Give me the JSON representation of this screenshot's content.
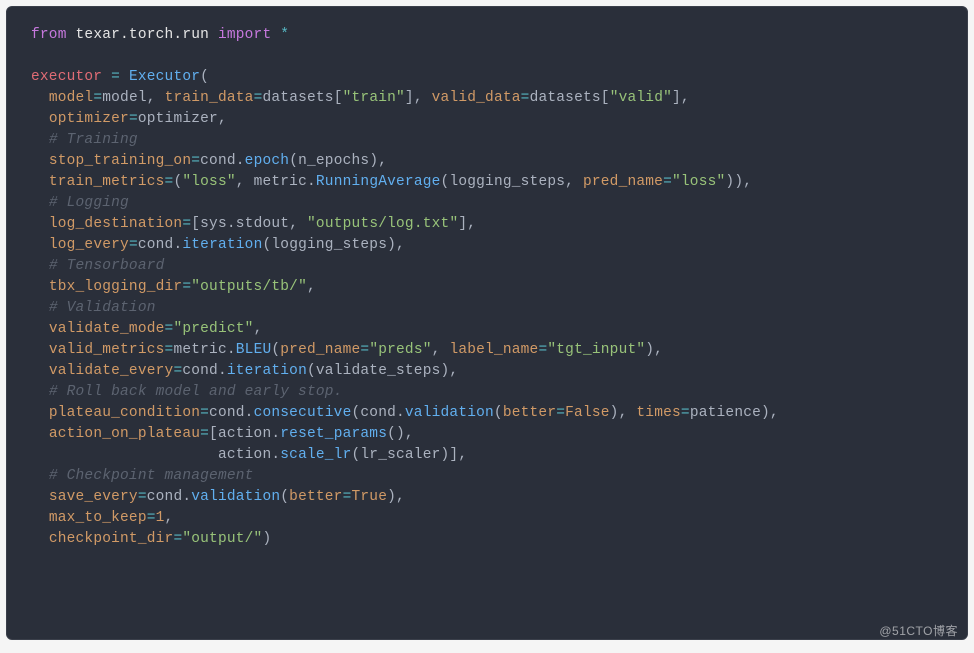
{
  "code": {
    "l1": {
      "from": "from",
      "mod": "texar.torch.run",
      "imp": "import",
      "star": "*"
    },
    "l3": {
      "lhs": "executor",
      "eq": "=",
      "fn": "Executor",
      "open": "("
    },
    "l4": {
      "p1": "model",
      "v1": "model",
      "p2": "train_data",
      "v2a": "datasets",
      "v2b": "\"train\"",
      "p3": "valid_data",
      "v3a": "datasets",
      "v3b": "\"valid\""
    },
    "l5": {
      "p": "optimizer",
      "v": "optimizer"
    },
    "l6": {
      "c": "# Training"
    },
    "l7": {
      "p": "stop_training_on",
      "obj": "cond",
      "fn": "epoch",
      "arg": "n_epochs"
    },
    "l8": {
      "p": "train_metrics",
      "s": "\"loss\"",
      "obj": "metric",
      "fn": "RunningAverage",
      "a1": "logging_steps",
      "a2p": "pred_name",
      "a2v": "\"loss\""
    },
    "l9": {
      "c": "# Logging"
    },
    "l10": {
      "p": "log_destination",
      "o1a": "sys",
      "o1b": "stdout",
      "s": "\"outputs/log.txt\""
    },
    "l11": {
      "p": "log_every",
      "obj": "cond",
      "fn": "iteration",
      "arg": "logging_steps"
    },
    "l12": {
      "c": "# Tensorboard"
    },
    "l13": {
      "p": "tbx_logging_dir",
      "v": "\"outputs/tb/\""
    },
    "l14": {
      "c": "# Validation"
    },
    "l15": {
      "p": "validate_mode",
      "v": "\"predict\""
    },
    "l16": {
      "p": "valid_metrics",
      "obj": "metric",
      "fn": "BLEU",
      "a1p": "pred_name",
      "a1v": "\"preds\"",
      "a2p": "label_name",
      "a2v": "\"tgt_input\""
    },
    "l17": {
      "p": "validate_every",
      "obj": "cond",
      "fn": "iteration",
      "arg": "validate_steps"
    },
    "l18": {
      "c": "# Roll back model and early stop."
    },
    "l19": {
      "p": "plateau_condition",
      "obj": "cond",
      "fn": "consecutive",
      "obj2": "cond",
      "fn2": "validation",
      "a1p": "better",
      "a1v": "False",
      "a2p": "times",
      "a2v": "patience"
    },
    "l20": {
      "p": "action_on_plateau",
      "obj": "action",
      "fn": "reset_params"
    },
    "l21": {
      "obj": "action",
      "fn": "scale_lr",
      "arg": "lr_scaler"
    },
    "l22": {
      "c": "# Checkpoint management"
    },
    "l23": {
      "p": "save_every",
      "obj": "cond",
      "fn": "validation",
      "a1p": "better",
      "a1v": "True"
    },
    "l24": {
      "p": "max_to_keep",
      "v": "1"
    },
    "l25": {
      "p": "checkpoint_dir",
      "v": "\"output/\""
    }
  },
  "watermark": "@51CTO博客"
}
